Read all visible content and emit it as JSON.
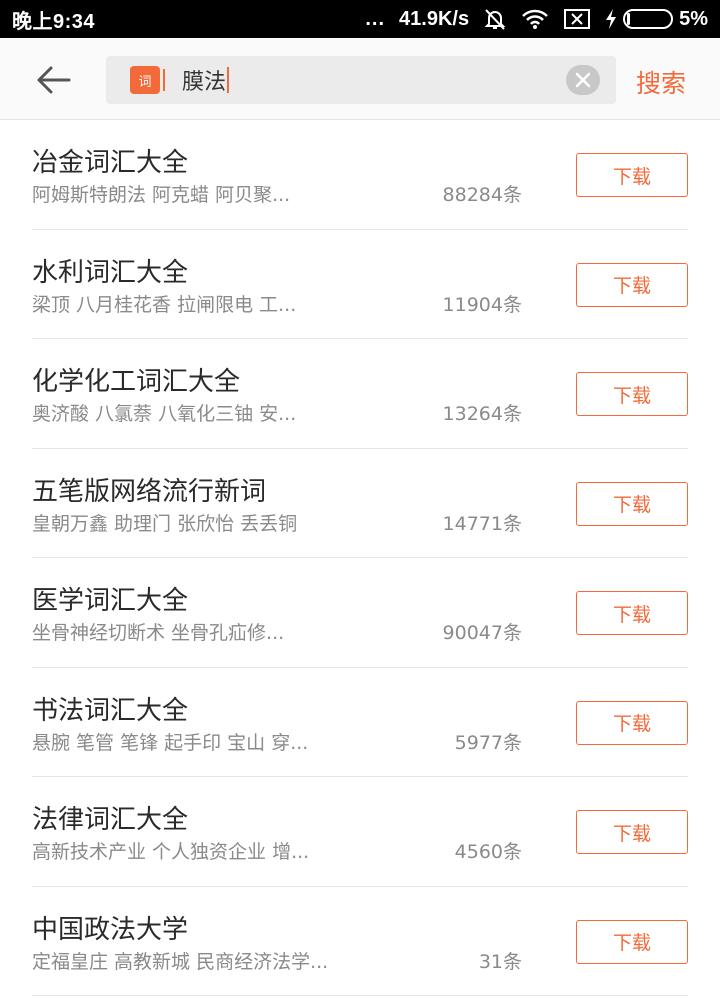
{
  "status_bar": {
    "time": "晚上9:34",
    "dots": "...",
    "speed": "41.9K/s",
    "battery": "5%"
  },
  "search": {
    "badge": "词",
    "query": "膜法",
    "submit_label": "搜索"
  },
  "accent_color": "#f26a3a",
  "results": [
    {
      "title": "冶金词汇大全",
      "words": "阿姆斯特朗法 阿克蜡 阿贝聚...",
      "count": "88284条",
      "action": "下载"
    },
    {
      "title": "水利词汇大全",
      "words": "梁顶 八月桂花香 拉闸限电 工...",
      "count": "11904条",
      "action": "下载"
    },
    {
      "title": "化学化工词汇大全",
      "words": "奥济酸 八氯萘 八氧化三铀 安...",
      "count": "13264条",
      "action": "下载"
    },
    {
      "title": "五笔版网络流行新词",
      "words": "皇朝万鑫 助理门 张欣怡 丢丢铜",
      "count": "14771条",
      "action": "下载"
    },
    {
      "title": "医学词汇大全",
      "words": "坐骨神经切断术 坐骨孔疝修...",
      "count": "90047条",
      "action": "下载"
    },
    {
      "title": "书法词汇大全",
      "words": "悬腕 笔管 笔锋 起手印 宝山 穿...",
      "count": "5977条",
      "action": "下载"
    },
    {
      "title": "法律词汇大全",
      "words": "高新技术产业 个人独资企业 增...",
      "count": "4560条",
      "action": "下载"
    },
    {
      "title": "中国政法大学",
      "words": "定福皇庄 高教新城 民商经济法学...",
      "count": "31条",
      "action": "下载"
    }
  ]
}
